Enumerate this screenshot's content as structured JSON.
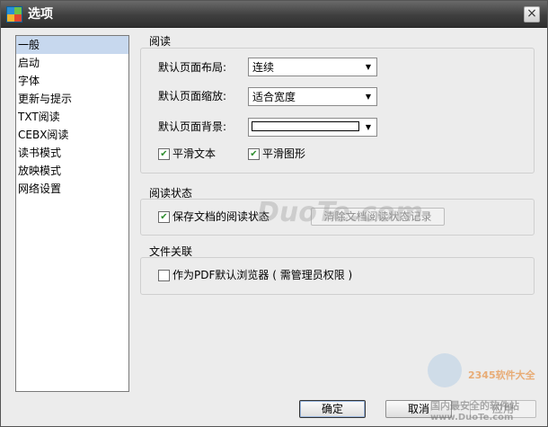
{
  "window": {
    "title": "选项"
  },
  "nav": {
    "items": [
      "一般",
      "启动",
      "字体",
      "更新与提示",
      "TXT阅读",
      "CEBX阅读",
      "读书模式",
      "放映模式",
      "网络设置"
    ],
    "selected_index": 0
  },
  "reading": {
    "group_label": "阅读",
    "layout_label": "默认页面布局:",
    "layout_value": "连续",
    "zoom_label": "默认页面缩放:",
    "zoom_value": "适合宽度",
    "background_label": "默认页面背景:",
    "background_color": "#ffffff",
    "smooth_text_label": "平滑文本",
    "smooth_text_checked": true,
    "smooth_graphics_label": "平滑图形",
    "smooth_graphics_checked": true
  },
  "reading_state": {
    "group_label": "阅读状态",
    "save_label": "保存文档的阅读状态",
    "save_checked": true,
    "clear_button_label": "清除文档阅读状态记录"
  },
  "file_assoc": {
    "group_label": "文件关联",
    "default_viewer_label": "作为PDF默认浏览器 ( 需管理员权限 )",
    "default_viewer_checked": false
  },
  "buttons": {
    "ok": "确定",
    "cancel": "取消",
    "apply": "应用"
  },
  "icons": {
    "app": "app-grid-icon",
    "close": "close-icon",
    "dropdown": "dropdown-arrow-icon",
    "check": "checkmark-icon"
  },
  "watermark": {
    "center": "DuoTe.com",
    "brand": "2345软件大全",
    "tagline": "国内最安全的软件站",
    "url": "www.DuoTe.com"
  }
}
